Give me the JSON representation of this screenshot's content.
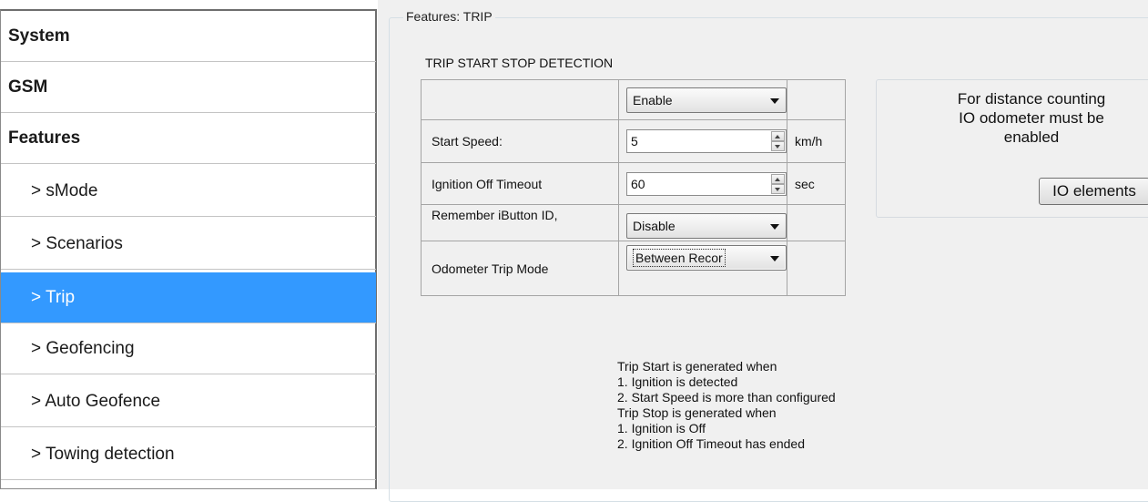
{
  "sidebar": {
    "items": [
      {
        "label": "System"
      },
      {
        "label": "GSM"
      },
      {
        "label": "Features"
      },
      {
        "label": "> sMode"
      },
      {
        "label": "> Scenarios"
      },
      {
        "label": "> Trip"
      },
      {
        "label": "> Geofencing"
      },
      {
        "label": "> Auto Geofence"
      },
      {
        "label": "> Towing detection"
      }
    ]
  },
  "panel": {
    "title": "Features: TRIP",
    "section_title": "TRIP START STOP DETECTION",
    "rows": {
      "mode": {
        "value": "Enable"
      },
      "start_speed": {
        "label": "Start Speed:",
        "value": "5",
        "unit": "km/h"
      },
      "ignition_timeout": {
        "label": "Ignition Off Timeout",
        "value": "60",
        "unit": "sec"
      },
      "remember_ibutton": {
        "label": "Remember iButton ID,",
        "value": "Disable"
      },
      "odometer_mode": {
        "label": "Odometer Trip Mode",
        "value": "Between Recor"
      }
    },
    "info": {
      "line1": "For distance counting",
      "line2": "IO odometer must be",
      "line3": "enabled",
      "button": "IO elements"
    },
    "notes": [
      "Trip Start is generated when",
      "1. Ignition is detected",
      "2. Start Speed is more than configured",
      "Trip Stop is generated when",
      "1. Ignition is Off",
      "2. Ignition Off Timeout has ended"
    ]
  },
  "colors": {
    "selected": "#3399ff",
    "panel_bg": "#f0f0f0"
  }
}
